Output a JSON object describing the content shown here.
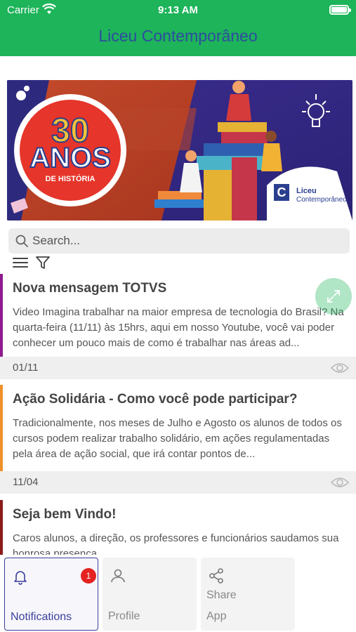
{
  "status_bar": {
    "carrier": "Carrier",
    "time": "9:13 AM"
  },
  "header": {
    "title": "Liceu Contemporâneo",
    "background_color": "#1db45a",
    "title_color": "#2e4c9e"
  },
  "banner": {
    "badge_number": "30",
    "badge_word": "ANOS",
    "badge_subtitle": "DE HISTÓRIA",
    "logo_name": "Liceu",
    "logo_subname": "Contemporâneo"
  },
  "search": {
    "placeholder": "Search...",
    "value": ""
  },
  "toolbar": {
    "menu_icon": "hamburger-icon",
    "filter_icon": "filter-icon"
  },
  "messages": [
    {
      "title": "Nova mensagem TOTVS",
      "body": "Video Imagina trabalhar na maior empresa de tecnologia do Brasil?  Na quarta-feira (11/11) às 15hrs, aqui em nosso Youtube, você vai poder conhecer um pouco mais de como é trabalhar nas áreas ad...",
      "date": "01/11",
      "accent_color": "#8e1a8e"
    },
    {
      "title": "Ação Solidária - Como você pode participar?",
      "body": "Tradicionalmente, nos meses de Julho e Agosto os alunos de todos os cursos podem realizar trabalho solidário, em ações regulamentadas pela área de ação social, que irá contar pontos de...",
      "date": "11/04",
      "accent_color": "#f0902a"
    },
    {
      "title": "Seja bem Vindo!",
      "body": "Caros alunos, a direção, os professores e funcionários saudamos sua honrosa presença...",
      "date": "",
      "accent_color": "#8b1a1a"
    }
  ],
  "tabs": [
    {
      "label": "Notifications",
      "icon": "bell-icon",
      "badge": "1",
      "active": true
    },
    {
      "label": "Profile",
      "icon": "person-icon",
      "active": false
    },
    {
      "label_line1": "Share",
      "label_line2": "App",
      "icon": "share-icon",
      "active": false
    }
  ]
}
